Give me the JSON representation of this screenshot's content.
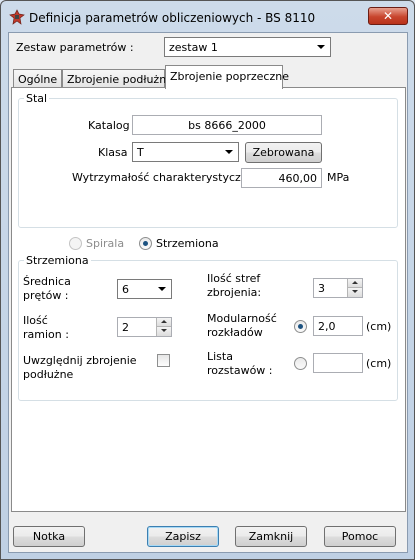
{
  "window": {
    "title": "Definicja parametrów obliczeniowych - BS 8110",
    "close_glyph": "✕"
  },
  "param_set": {
    "label": "Zestaw parametrów :",
    "value": "zestaw 1"
  },
  "tabs": [
    {
      "label": "Ogólne"
    },
    {
      "label": "Zbrojenie podłużne"
    },
    {
      "label": "Zbrojenie poprzeczne",
      "active": true
    }
  ],
  "steel": {
    "group_title": "Stal",
    "catalog_label": "Katalog",
    "catalog_value": "bs 8666_2000",
    "class_label": "Klasa",
    "class_value": "T",
    "class_type_button": "Zebrowana",
    "strength_label": "Wytrzymałość charakterystyczna",
    "strength_value": "460,00",
    "strength_unit": "MPa"
  },
  "type_choice": {
    "spiral_label": "Spirala",
    "stirrups_label": "Strzemiona",
    "selected": "stirrups"
  },
  "stirrups": {
    "group_title": "Strzemiona",
    "diameter_label_1": "Średnica",
    "diameter_label_2": "prętów :",
    "diameter_value": "6",
    "legs_label_1": "Ilość",
    "legs_label_2": "ramion :",
    "legs_value": "2",
    "include_long_label_1": "Uwzględnij zbrojenie",
    "include_long_label_2": "podłużne",
    "include_long_checked": false,
    "zones_label_1": "Ilość stref",
    "zones_label_2": "zbrojenia:",
    "zones_value": "3",
    "modular_label_1": "Modularność",
    "modular_label_2": "rozkładów",
    "modular_value": "2,0",
    "modular_unit": "(cm)",
    "modular_selected": true,
    "spacing_label_1": "Lista",
    "spacing_label_2": "rozstawów :",
    "spacing_value": "",
    "spacing_unit": "(cm)"
  },
  "buttons": {
    "notes": "Notka",
    "save": "Zapisz",
    "close": "Zamknij",
    "help": "Pomoc"
  },
  "colors": {
    "accent": "#1c5280",
    "close_button": "#c8452d"
  }
}
